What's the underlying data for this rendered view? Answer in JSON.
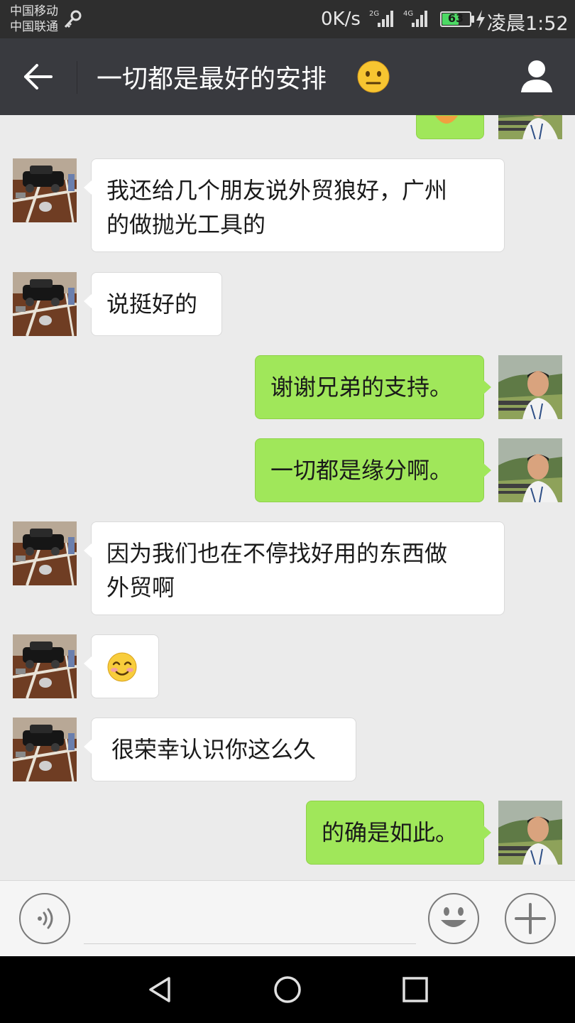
{
  "status_bar": {
    "carrier_1": "中国移动",
    "carrier_2": "中国联通",
    "speed": "0K/s",
    "net_1": "2G",
    "net_2": "4G",
    "battery": "63",
    "time": "凌晨1:52"
  },
  "header": {
    "title": "一切都是最好的安排",
    "title_emoji": "neutral-face-emoji",
    "back_icon": "back-arrow-icon",
    "profile_icon": "person-icon"
  },
  "messages": [
    {
      "side": "in",
      "text_1": "我还给几个朋友说外贸狼好，广州",
      "text_2": "的做抛光工具的"
    },
    {
      "side": "in",
      "text": "说挺好的"
    },
    {
      "side": "out",
      "text": "谢谢兄弟的支持。"
    },
    {
      "side": "out",
      "text": "一切都是缘分啊。"
    },
    {
      "side": "in",
      "text_1": "因为我们也在不停找好用的东西做",
      "text_2": "外贸啊"
    },
    {
      "side": "in",
      "emoji": "smiling-face-emoji"
    },
    {
      "side": "in",
      "text": "很荣幸认识你这么久"
    },
    {
      "side": "out",
      "text": "的确是如此。"
    }
  ],
  "input_bar": {
    "voice_icon": "voice-icon",
    "emoji_icon": "emoji-icon",
    "plus_icon": "plus-icon"
  },
  "nav_bar": {
    "back": "nav-back-icon",
    "home": "nav-home-icon",
    "recents": "nav-recents-icon"
  },
  "colors": {
    "titlebar": "#393a3f",
    "chat_bg": "#ebebeb",
    "outgoing_bubble": "#a0e75a",
    "incoming_bubble": "#ffffff"
  }
}
